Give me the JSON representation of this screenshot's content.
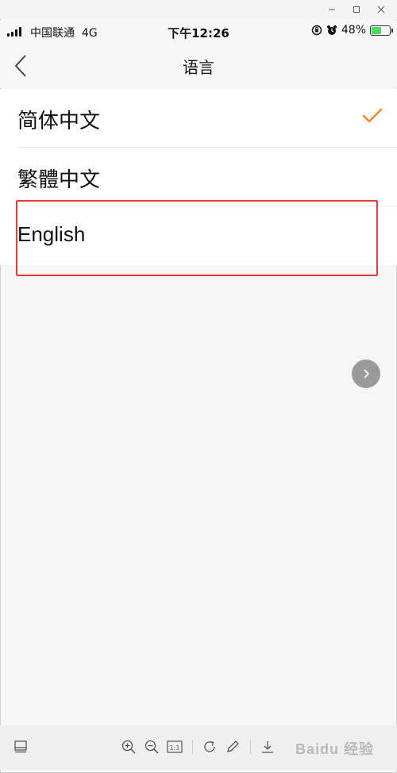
{
  "status_bar": {
    "carrier": "中国联通",
    "network": "4G",
    "time": "下午12:26",
    "battery": "48%",
    "battery_level": 0.48
  },
  "nav": {
    "title": "语言",
    "back_icon": "chevron-left-icon"
  },
  "languages": [
    {
      "label": "简体中文",
      "selected": true
    },
    {
      "label": "繁體中文",
      "selected": false
    },
    {
      "label": "English",
      "selected": false
    }
  ],
  "colors": {
    "accent_check": "#f08a24",
    "highlight_box": "#e53935",
    "background": "#f6f6f6"
  },
  "toolbar": {
    "icons": [
      "layout-icon",
      "zoom-in-icon",
      "zoom-out-icon",
      "actual-size-icon",
      "rotate-icon",
      "edit-pen-icon",
      "download-icon"
    ],
    "actual_size_label": "1:1",
    "watermark": "Baidu 经验"
  }
}
